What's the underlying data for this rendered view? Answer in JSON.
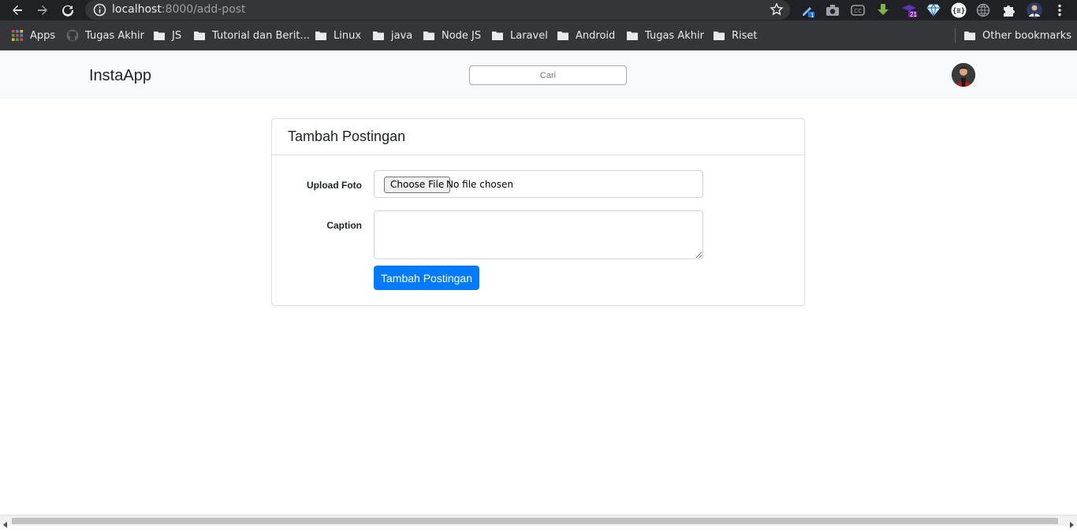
{
  "browser": {
    "url_host": "localhost",
    "url_path": ":8000/add-post",
    "bookmarks": [
      {
        "label": "Apps",
        "icon": "apps-grid-icon"
      },
      {
        "label": "Tugas Akhir",
        "icon": "github-icon"
      },
      {
        "label": "JS",
        "icon": "folder-icon"
      },
      {
        "label": "Tutorial dan Berit...",
        "icon": "folder-icon"
      },
      {
        "label": "Linux",
        "icon": "folder-icon"
      },
      {
        "label": "java",
        "icon": "folder-icon"
      },
      {
        "label": "Node JS",
        "icon": "folder-icon"
      },
      {
        "label": "Laravel",
        "icon": "folder-icon"
      },
      {
        "label": "Android",
        "icon": "folder-icon"
      },
      {
        "label": "Tugas Akhir",
        "icon": "folder-icon"
      },
      {
        "label": "Riset",
        "icon": "folder-icon"
      }
    ],
    "other_bookmarks": "Other bookmarks",
    "extension_badges": {
      "first": "1",
      "second": "21"
    }
  },
  "app": {
    "brand": "InstaApp",
    "search_placeholder": "Cari",
    "colors": {
      "primary": "#007bff",
      "nav_bg": "#f8f9fa"
    }
  },
  "form": {
    "title": "Tambah Postingan",
    "upload_label": "Upload Foto",
    "choose_file": "Choose File",
    "file_status": "No file chosen",
    "caption_label": "Caption",
    "caption_value": "",
    "submit_label": "Tambah Postingan"
  }
}
